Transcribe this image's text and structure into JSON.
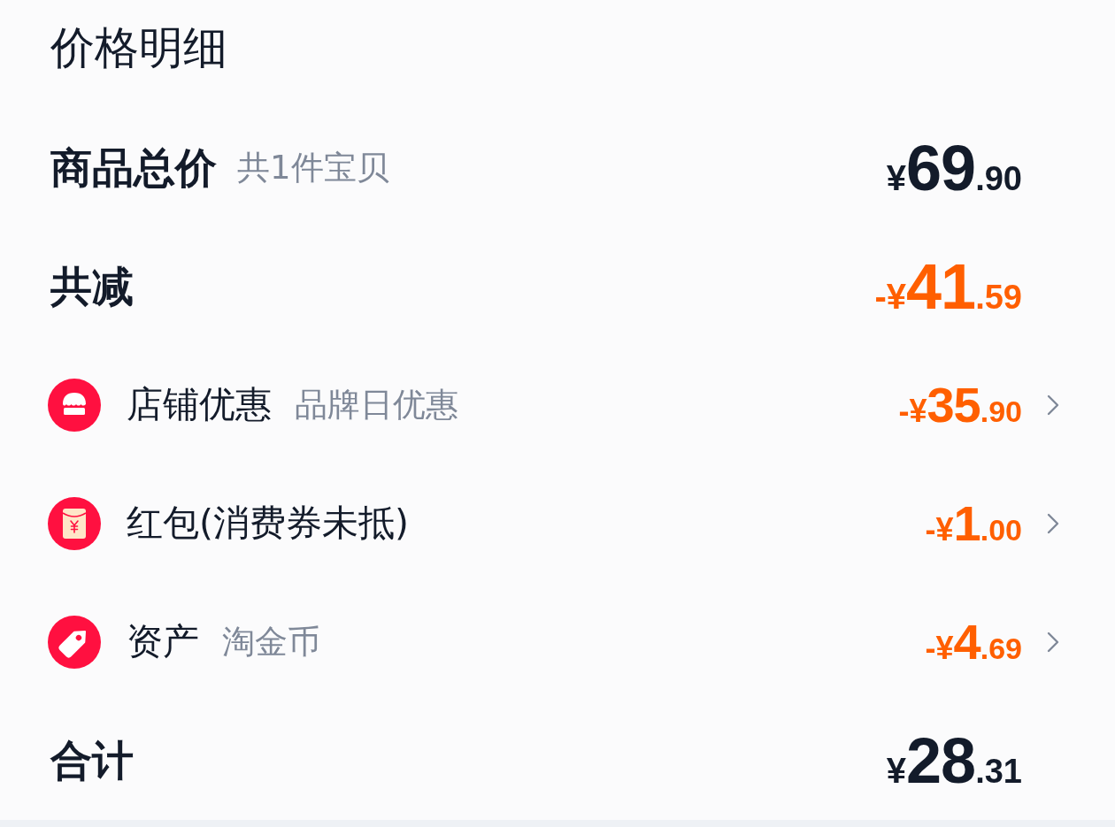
{
  "title": "价格明细",
  "rows": [
    {
      "kind": "summary",
      "label": "商品总价",
      "note": "共1件宝贝",
      "amount": {
        "prefix": "¥",
        "whole": "69",
        "fraction": ".90"
      }
    },
    {
      "kind": "discount",
      "label": "共减",
      "amount": {
        "prefix": "-¥",
        "whole": "41",
        "fraction": ".59"
      }
    },
    {
      "kind": "detail",
      "label": "店铺优惠",
      "note": "品牌日优惠",
      "amount": {
        "prefix": "-¥",
        "whole": "35",
        "fraction": ".90"
      }
    },
    {
      "kind": "detail",
      "label": "红包(消费券未抵)",
      "amount": {
        "prefix": "-¥",
        "whole": "1",
        "fraction": ".00"
      }
    },
    {
      "kind": "detail",
      "label": "资产",
      "note": "淘金币",
      "amount": {
        "prefix": "-¥",
        "whole": "4",
        "fraction": ".69"
      }
    },
    {
      "kind": "summary",
      "label": "合计",
      "amount": {
        "prefix": "¥",
        "whole": "28",
        "fraction": ".31"
      }
    }
  ]
}
